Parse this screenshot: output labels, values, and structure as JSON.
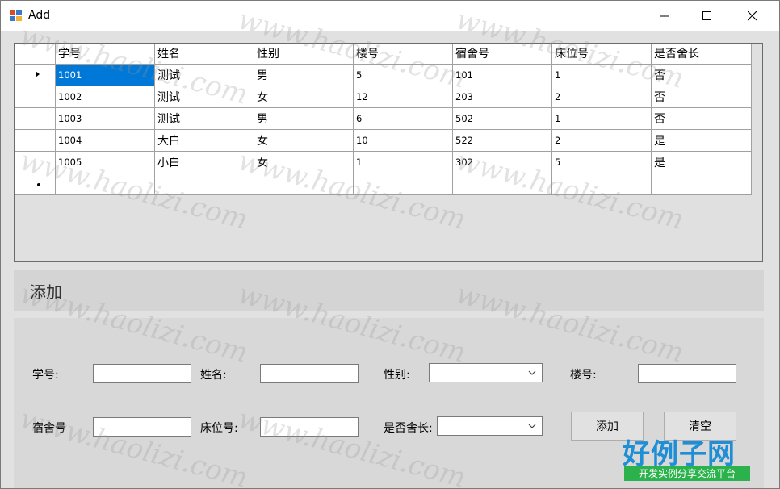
{
  "window": {
    "title": "Add"
  },
  "grid": {
    "columns": [
      "学号",
      "姓名",
      "性别",
      "楼号",
      "宿舍号",
      "床位号",
      "是否舍长"
    ],
    "rows": [
      [
        "1001",
        "测试",
        "男",
        "5",
        "101",
        "1",
        "否"
      ],
      [
        "1002",
        "测试",
        "女",
        "12",
        "203",
        "2",
        "否"
      ],
      [
        "1003",
        "测试",
        "男",
        "6",
        "502",
        "1",
        "否"
      ],
      [
        "1004",
        "大白",
        "女",
        "10",
        "522",
        "2",
        "是"
      ],
      [
        "1005",
        "小白",
        "女",
        "1",
        "302",
        "5",
        "是"
      ]
    ]
  },
  "section": {
    "title": "添加"
  },
  "form": {
    "labels": {
      "student_id": "学号:",
      "name": "姓名:",
      "gender": "性别:",
      "building": "楼号:",
      "dorm": "宿舍号",
      "bed": "床位号:",
      "is_leader": "是否舍长:"
    },
    "values": {
      "student_id": "",
      "name": "",
      "building": "",
      "dorm": "",
      "bed": "",
      "gender": "",
      "is_leader": ""
    },
    "buttons": {
      "add": "添加",
      "clear": "清空"
    }
  },
  "watermark": {
    "text": "www.haolizi.com"
  },
  "logo": {
    "main": "好例子网",
    "sub": "开发实例分享交流平台"
  },
  "colors": {
    "selection": "#0078d7",
    "logo_blue": "#1e8fd6",
    "logo_green": "#2bb24c"
  }
}
